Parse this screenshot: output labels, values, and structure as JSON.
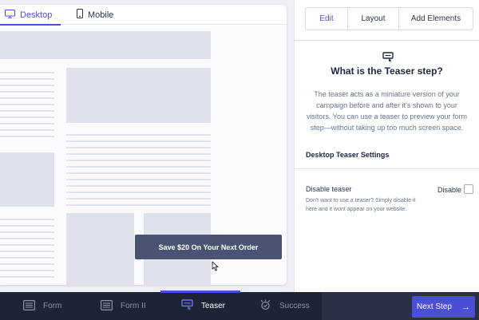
{
  "preview": {
    "tabs": [
      {
        "label": "Desktop",
        "icon": "desktop-icon",
        "active": true
      },
      {
        "label": "Mobile",
        "icon": "mobile-icon",
        "active": false
      }
    ],
    "teaser_button_label": "Save $20 On Your Next Order"
  },
  "panel": {
    "mode_tabs": [
      "Edit",
      "Layout",
      "Add Elements"
    ],
    "active_mode": "Edit",
    "title": "What is the Teaser step?",
    "description": "The teaser acts as a miniature version of your campaign before and after it's shown to your visitors. You can use a teaser to preview your form step—without taking up too much screen space.",
    "section_title": "Desktop Teaser Settings",
    "setting": {
      "label": "Disable teaser",
      "help": "Don't want to use a teaser? Simply disable it here and it wont appear on your website.",
      "checkbox_label": "Disable",
      "checked": false
    }
  },
  "nav": {
    "steps": [
      {
        "label": "Form",
        "icon": "form-icon",
        "active": false
      },
      {
        "label": "Form II",
        "icon": "form-icon",
        "active": false
      },
      {
        "label": "Teaser",
        "icon": "teaser-icon",
        "active": true
      },
      {
        "label": "Success",
        "icon": "success-icon",
        "active": false
      }
    ],
    "next_label": "Next Step"
  },
  "colors": {
    "accent": "#4a4fd6",
    "nav_bg": "#1e2436",
    "teaser_button": "#495473",
    "placeholder": "#dfe2ec"
  }
}
